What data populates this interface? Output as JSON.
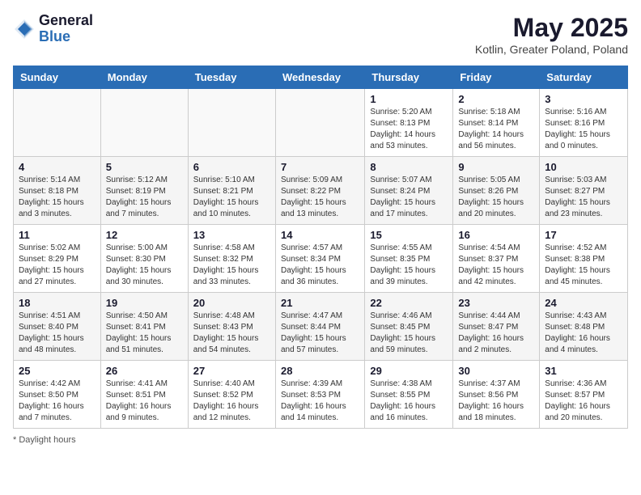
{
  "header": {
    "logo_general": "General",
    "logo_blue": "Blue",
    "month_title": "May 2025",
    "subtitle": "Kotlin, Greater Poland, Poland"
  },
  "footer": {
    "note": "Daylight hours"
  },
  "days_of_week": [
    "Sunday",
    "Monday",
    "Tuesday",
    "Wednesday",
    "Thursday",
    "Friday",
    "Saturday"
  ],
  "weeks": [
    [
      {
        "num": "",
        "info": ""
      },
      {
        "num": "",
        "info": ""
      },
      {
        "num": "",
        "info": ""
      },
      {
        "num": "",
        "info": ""
      },
      {
        "num": "1",
        "info": "Sunrise: 5:20 AM\nSunset: 8:13 PM\nDaylight: 14 hours\nand 53 minutes."
      },
      {
        "num": "2",
        "info": "Sunrise: 5:18 AM\nSunset: 8:14 PM\nDaylight: 14 hours\nand 56 minutes."
      },
      {
        "num": "3",
        "info": "Sunrise: 5:16 AM\nSunset: 8:16 PM\nDaylight: 15 hours\nand 0 minutes."
      }
    ],
    [
      {
        "num": "4",
        "info": "Sunrise: 5:14 AM\nSunset: 8:18 PM\nDaylight: 15 hours\nand 3 minutes."
      },
      {
        "num": "5",
        "info": "Sunrise: 5:12 AM\nSunset: 8:19 PM\nDaylight: 15 hours\nand 7 minutes."
      },
      {
        "num": "6",
        "info": "Sunrise: 5:10 AM\nSunset: 8:21 PM\nDaylight: 15 hours\nand 10 minutes."
      },
      {
        "num": "7",
        "info": "Sunrise: 5:09 AM\nSunset: 8:22 PM\nDaylight: 15 hours\nand 13 minutes."
      },
      {
        "num": "8",
        "info": "Sunrise: 5:07 AM\nSunset: 8:24 PM\nDaylight: 15 hours\nand 17 minutes."
      },
      {
        "num": "9",
        "info": "Sunrise: 5:05 AM\nSunset: 8:26 PM\nDaylight: 15 hours\nand 20 minutes."
      },
      {
        "num": "10",
        "info": "Sunrise: 5:03 AM\nSunset: 8:27 PM\nDaylight: 15 hours\nand 23 minutes."
      }
    ],
    [
      {
        "num": "11",
        "info": "Sunrise: 5:02 AM\nSunset: 8:29 PM\nDaylight: 15 hours\nand 27 minutes."
      },
      {
        "num": "12",
        "info": "Sunrise: 5:00 AM\nSunset: 8:30 PM\nDaylight: 15 hours\nand 30 minutes."
      },
      {
        "num": "13",
        "info": "Sunrise: 4:58 AM\nSunset: 8:32 PM\nDaylight: 15 hours\nand 33 minutes."
      },
      {
        "num": "14",
        "info": "Sunrise: 4:57 AM\nSunset: 8:34 PM\nDaylight: 15 hours\nand 36 minutes."
      },
      {
        "num": "15",
        "info": "Sunrise: 4:55 AM\nSunset: 8:35 PM\nDaylight: 15 hours\nand 39 minutes."
      },
      {
        "num": "16",
        "info": "Sunrise: 4:54 AM\nSunset: 8:37 PM\nDaylight: 15 hours\nand 42 minutes."
      },
      {
        "num": "17",
        "info": "Sunrise: 4:52 AM\nSunset: 8:38 PM\nDaylight: 15 hours\nand 45 minutes."
      }
    ],
    [
      {
        "num": "18",
        "info": "Sunrise: 4:51 AM\nSunset: 8:40 PM\nDaylight: 15 hours\nand 48 minutes."
      },
      {
        "num": "19",
        "info": "Sunrise: 4:50 AM\nSunset: 8:41 PM\nDaylight: 15 hours\nand 51 minutes."
      },
      {
        "num": "20",
        "info": "Sunrise: 4:48 AM\nSunset: 8:43 PM\nDaylight: 15 hours\nand 54 minutes."
      },
      {
        "num": "21",
        "info": "Sunrise: 4:47 AM\nSunset: 8:44 PM\nDaylight: 15 hours\nand 57 minutes."
      },
      {
        "num": "22",
        "info": "Sunrise: 4:46 AM\nSunset: 8:45 PM\nDaylight: 15 hours\nand 59 minutes."
      },
      {
        "num": "23",
        "info": "Sunrise: 4:44 AM\nSunset: 8:47 PM\nDaylight: 16 hours\nand 2 minutes."
      },
      {
        "num": "24",
        "info": "Sunrise: 4:43 AM\nSunset: 8:48 PM\nDaylight: 16 hours\nand 4 minutes."
      }
    ],
    [
      {
        "num": "25",
        "info": "Sunrise: 4:42 AM\nSunset: 8:50 PM\nDaylight: 16 hours\nand 7 minutes."
      },
      {
        "num": "26",
        "info": "Sunrise: 4:41 AM\nSunset: 8:51 PM\nDaylight: 16 hours\nand 9 minutes."
      },
      {
        "num": "27",
        "info": "Sunrise: 4:40 AM\nSunset: 8:52 PM\nDaylight: 16 hours\nand 12 minutes."
      },
      {
        "num": "28",
        "info": "Sunrise: 4:39 AM\nSunset: 8:53 PM\nDaylight: 16 hours\nand 14 minutes."
      },
      {
        "num": "29",
        "info": "Sunrise: 4:38 AM\nSunset: 8:55 PM\nDaylight: 16 hours\nand 16 minutes."
      },
      {
        "num": "30",
        "info": "Sunrise: 4:37 AM\nSunset: 8:56 PM\nDaylight: 16 hours\nand 18 minutes."
      },
      {
        "num": "31",
        "info": "Sunrise: 4:36 AM\nSunset: 8:57 PM\nDaylight: 16 hours\nand 20 minutes."
      }
    ]
  ]
}
